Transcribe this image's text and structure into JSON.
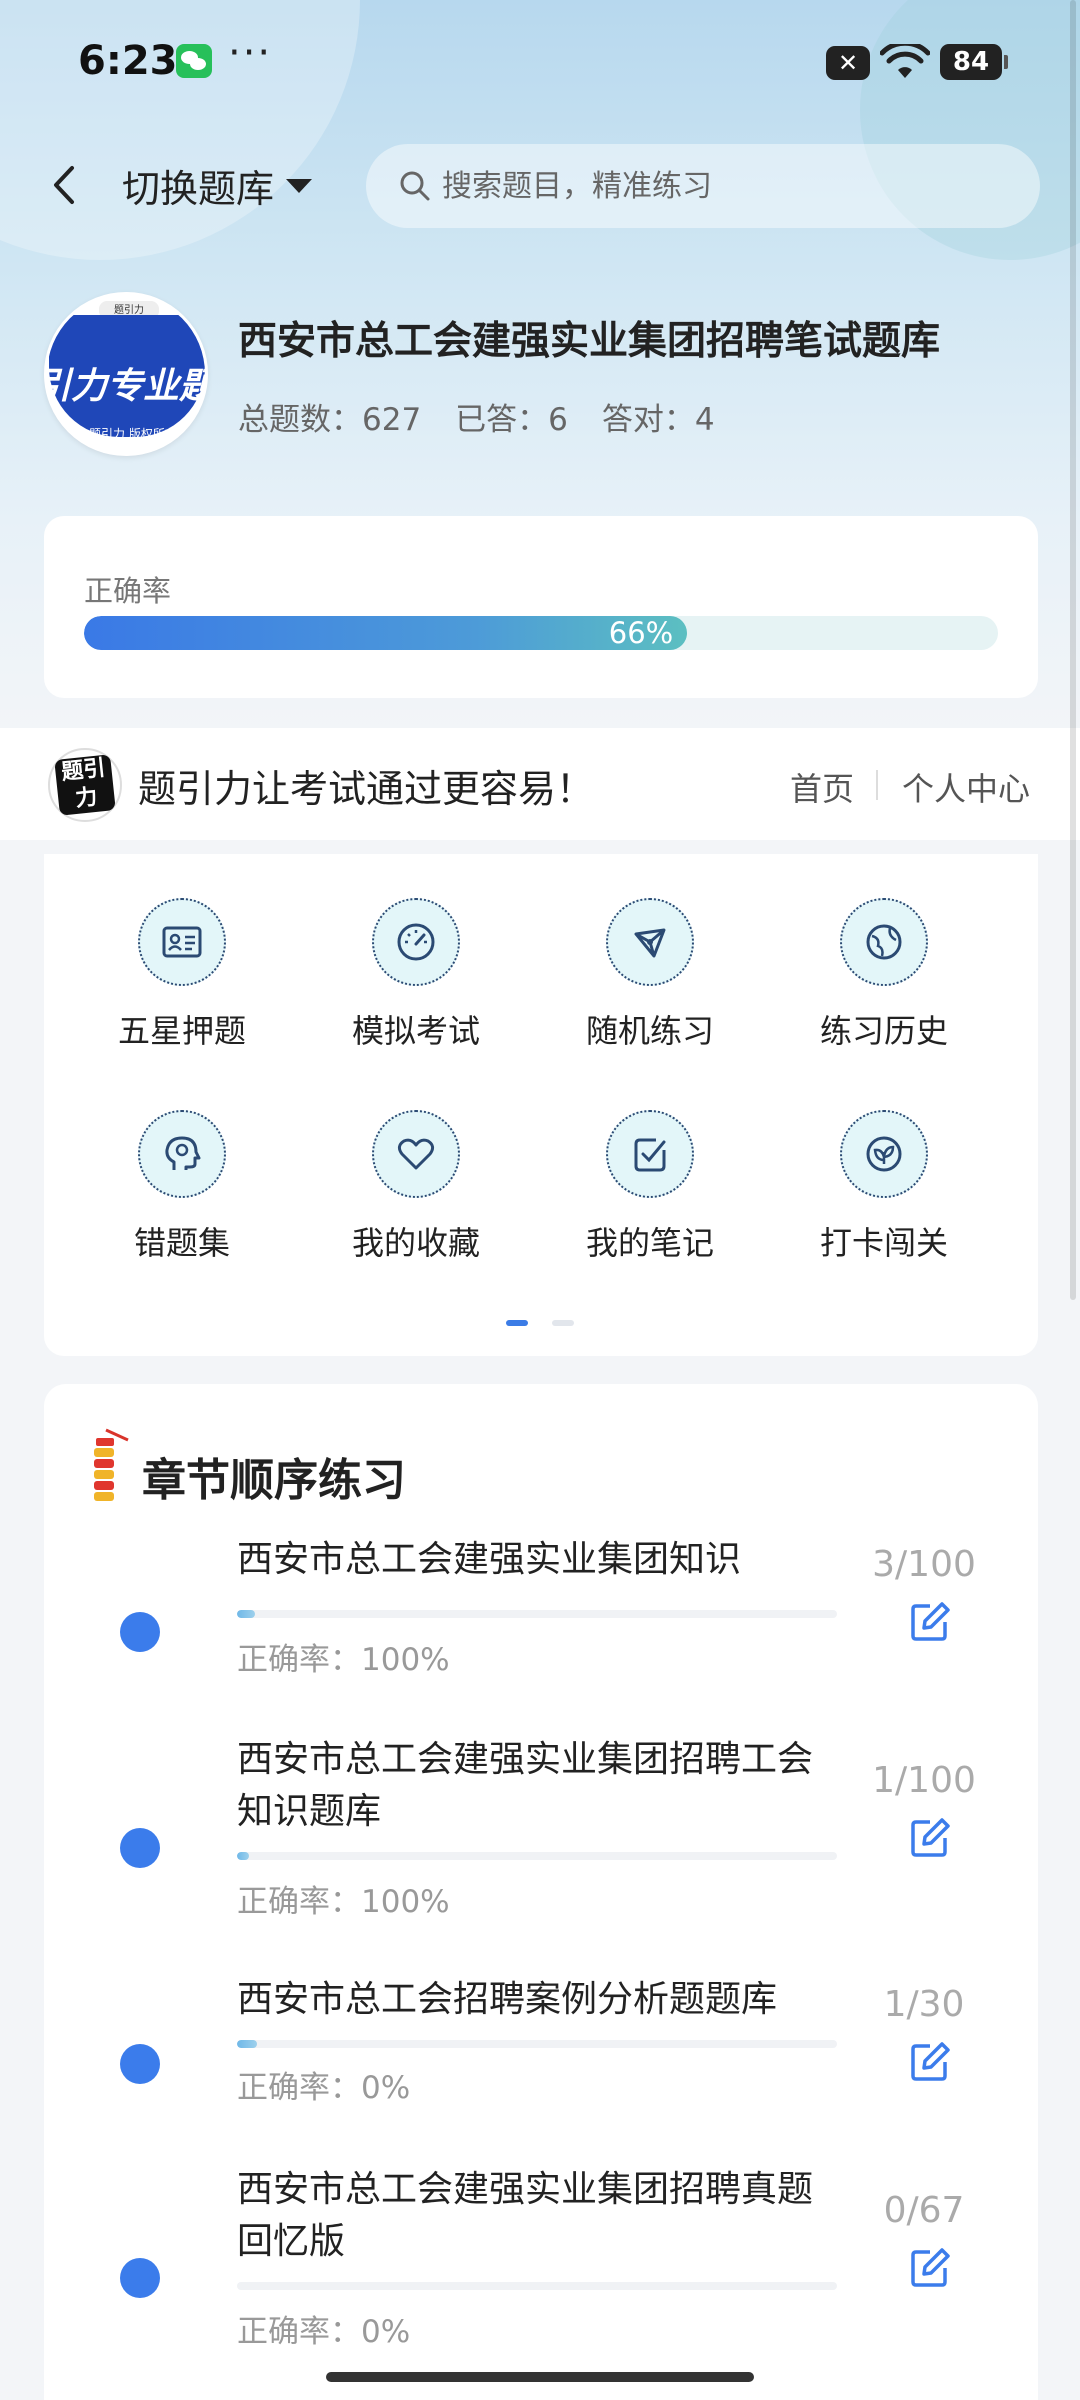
{
  "status_bar": {
    "time": "6:23",
    "dots": "···",
    "nfc": "N",
    "battery": "84"
  },
  "header": {
    "switch_label": "切换题库",
    "search_placeholder": "搜索题目，精准练习"
  },
  "bank": {
    "logo_text": "引力专业题",
    "logo_tag": "题引力",
    "logo_small": "题引力 版权所有",
    "title": "西安市总工会建强实业集团招聘笔试题库",
    "stats": {
      "total": "总题数：627",
      "answered": "已答：6",
      "correct": "答对：4"
    }
  },
  "accuracy": {
    "label": "正确率",
    "value_text": "66%",
    "fraction": 0.66
  },
  "brand": {
    "logo": "题引力",
    "slogan": "题引力让考试通过更容易！",
    "home": "首页",
    "me": "个人中心"
  },
  "functions": [
    {
      "label": "五星押题",
      "icon": "id-card-icon"
    },
    {
      "label": "模拟考试",
      "icon": "speedometer-icon"
    },
    {
      "label": "随机练习",
      "icon": "network-icon"
    },
    {
      "label": "练习历史",
      "icon": "globe-icon"
    },
    {
      "label": "错题集",
      "icon": "head-brain-icon"
    },
    {
      "label": "我的收藏",
      "icon": "heart-icon"
    },
    {
      "label": "我的笔记",
      "icon": "note-check-icon"
    },
    {
      "label": "打卡闯关",
      "icon": "leaf-badge-icon"
    }
  ],
  "chapters": {
    "title": "章节顺序练习",
    "items": [
      {
        "name": "西安市总工会建强实业集团知识",
        "accuracy": "正确率：100%",
        "count": "3/100",
        "progress": 0.03
      },
      {
        "name": "西安市总工会建强实业集团招聘工会知识题库",
        "accuracy": "正确率：100%",
        "count": "1/100",
        "progress": 0.01
      },
      {
        "name": "西安市总工会招聘案例分析题题库",
        "accuracy": "正确率：0%",
        "count": "1/30",
        "progress": 0.033
      },
      {
        "name": "西安市总工会建强实业集团招聘真题回忆版",
        "accuracy": "正确率：0%",
        "count": "0/67",
        "progress": 0
      }
    ]
  },
  "colors": {
    "accent": "#3b7ceb",
    "progress_start": "#3a79e6",
    "progress_end": "#5cbfc1"
  }
}
